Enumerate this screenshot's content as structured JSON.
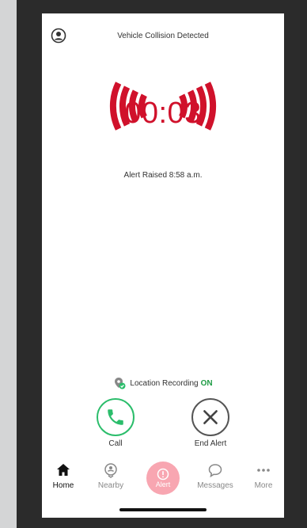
{
  "header": {
    "title": "Vehicle Collision Detected"
  },
  "alarm": {
    "timer": "00:03",
    "alert_raised": "Alert Raised 8:58 a.m.",
    "color": "#d0112b"
  },
  "location": {
    "label": "Location Recording",
    "status": "ON"
  },
  "actions": {
    "call": "Call",
    "end_alert": "End Alert"
  },
  "tabs": [
    {
      "label": "Home",
      "icon": "home-icon",
      "active": true
    },
    {
      "label": "Nearby",
      "icon": "nearby-icon"
    },
    {
      "label": "Alert",
      "icon": "alert-icon"
    },
    {
      "label": "Messages",
      "icon": "message-icon"
    },
    {
      "label": "More",
      "icon": "more-icon"
    }
  ]
}
